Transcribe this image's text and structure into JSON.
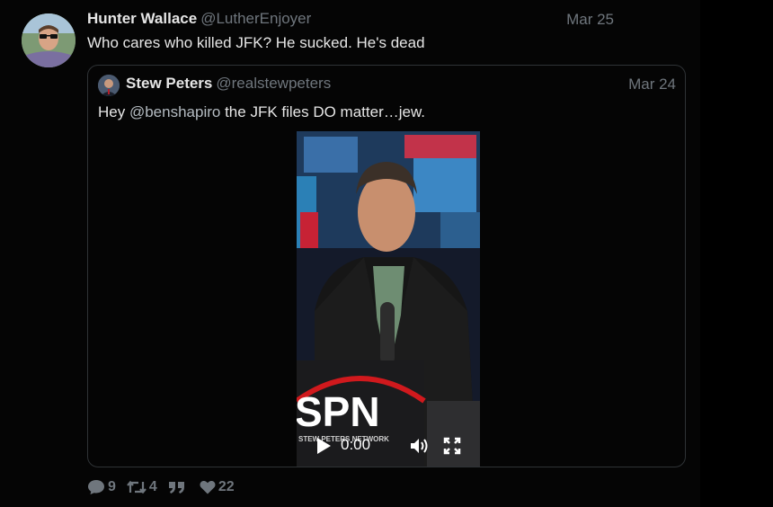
{
  "tweet": {
    "author_name": "Hunter Wallace",
    "author_handle": "@LutherEnjoyer",
    "date": "Mar 25",
    "text": "Who cares who killed JFK? He sucked. He's dead"
  },
  "quoted": {
    "author_name": "Stew Peters",
    "author_handle": "@realstewpeters",
    "date": "Mar 24",
    "text_before": "Hey ",
    "mention": "@benshapiro",
    "text_after": " the JFK files DO matter…jew.",
    "video": {
      "time": "0:00",
      "brand": "SPN",
      "brand_caption": "STEW PETERS NETWORK"
    }
  },
  "actions": {
    "replies": "9",
    "retweets": "4",
    "likes": "22"
  },
  "colors": {
    "text": "#e6e6e6",
    "muted": "#6f767d",
    "border": "#2f3336",
    "spn_red": "#d0191d"
  },
  "icons": [
    "reply-icon",
    "retweet-icon",
    "quote-icon",
    "like-icon",
    "play-icon",
    "volume-icon",
    "fullscreen-icon"
  ]
}
